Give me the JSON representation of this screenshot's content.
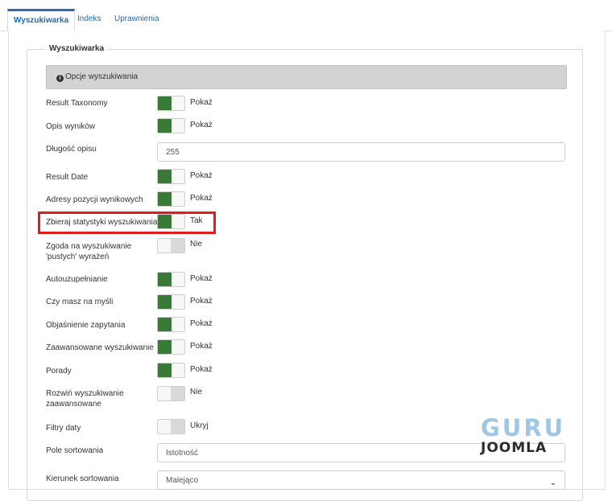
{
  "tabs": [
    {
      "label": "Wyszukiwarka",
      "active": true
    },
    {
      "label": "Indeks",
      "active": false
    },
    {
      "label": "Uprawnienia",
      "active": false
    }
  ],
  "fieldset": {
    "legend": "Wyszukiwarka"
  },
  "info": {
    "text": "Opcje wyszukiwania",
    "icon": "info-icon"
  },
  "fields": {
    "result_taxonomy": {
      "label": "Result Taxonomy",
      "value": "Pokaż",
      "on": true
    },
    "opis_wynikow": {
      "label": "Opis wyników",
      "value": "Pokaż",
      "on": true
    },
    "dlugosc_opisu": {
      "label": "Długość opisu",
      "value": "255"
    },
    "result_date": {
      "label": "Result Date",
      "value": "Pokaż",
      "on": true
    },
    "adresy": {
      "label": "Adresy pozycji wynikowych",
      "value": "Pokaż",
      "on": true
    },
    "statystyki": {
      "label": "Zbieraj statystyki wyszukiwania",
      "value": "Tak",
      "on": true
    },
    "zgoda": {
      "label_line1": "Zgoda na wyszukiwanie",
      "label_line2": "'pustych' wyrażeń",
      "value": "Nie",
      "on": false
    },
    "autouzupelnianie": {
      "label": "Autouzupełnianie",
      "value": "Pokaż",
      "on": true
    },
    "czy_masz": {
      "label": "Czy masz na myśli",
      "value": "Pokaż",
      "on": true
    },
    "objasnienie": {
      "label": "Objaśnienie zapytania",
      "value": "Pokaż",
      "on": true
    },
    "zaawansowane": {
      "label": "Zaawansowane wyszukiwanie",
      "value": "Pokaż",
      "on": true
    },
    "porady": {
      "label": "Porady",
      "value": "Pokaż",
      "on": true
    },
    "rozwin": {
      "label_line1": "Rozwiń wyszukiwanie",
      "label_line2": "zaawansowane",
      "value": "Nie",
      "on": false
    },
    "filtry_daty": {
      "label": "Filtry daty",
      "value": "Ukryj",
      "on": false
    },
    "pole_sortowania": {
      "label": "Pole sortowania",
      "value": "Istotność"
    },
    "kierunek_sortowania": {
      "label": "Kierunek sortowania",
      "value": "Malejąco"
    }
  },
  "colors": {
    "toggle_on": "#3a7a39",
    "highlight": "#e31b1b",
    "tab_link": "#1f6bb5"
  },
  "logo": {
    "line1": "GURU",
    "line2": "JOOMLA"
  }
}
